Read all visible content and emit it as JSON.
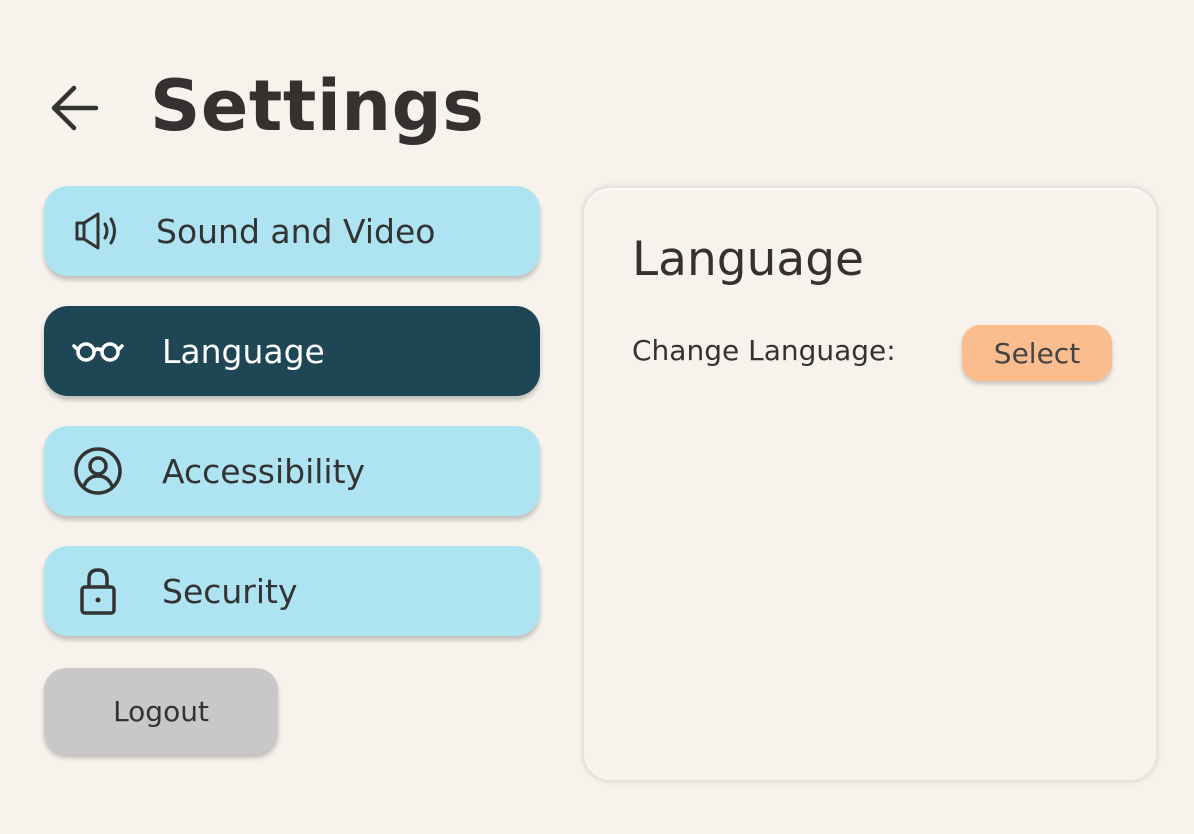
{
  "header": {
    "title": "Settings",
    "back_icon": "arrow-left-icon"
  },
  "sidebar": {
    "items": [
      {
        "label": "Sound and Video",
        "icon": "speaker-icon",
        "active": false
      },
      {
        "label": "Language",
        "icon": "glasses-icon",
        "active": true
      },
      {
        "label": "Accessibility",
        "icon": "user-circle-icon",
        "active": false
      },
      {
        "label": "Security",
        "icon": "lock-icon",
        "active": false
      }
    ],
    "logout_label": "Logout"
  },
  "panel": {
    "title": "Language",
    "change_label": "Change Language:",
    "select_label": "Select"
  },
  "colors": {
    "background": "#f7f3ec",
    "nav_item": "#aee4f2",
    "nav_item_active": "#1e4655",
    "logout": "#c8c8c8",
    "select_button": "#fbbd8d",
    "text": "#353131"
  }
}
